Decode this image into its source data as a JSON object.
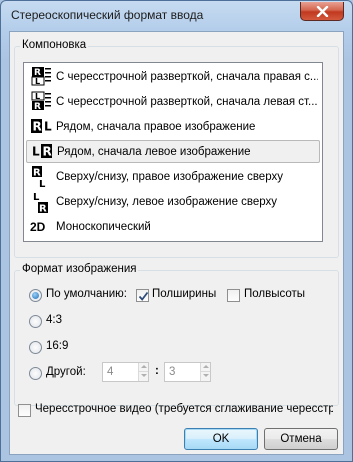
{
  "window": {
    "title": "Стереоскопический формат ввода"
  },
  "layout_group": {
    "label": "Компоновка",
    "items": [
      {
        "icon": "interlaced-right-first-icon",
        "label": "С чересстрочной разверткой, сначала правая с..."
      },
      {
        "icon": "interlaced-left-first-icon",
        "label": "С чересстрочной разверткой, сначала левая ст..."
      },
      {
        "icon": "side-by-side-right-first-icon",
        "label": "Рядом, сначала правое изображение"
      },
      {
        "icon": "side-by-side-left-first-icon",
        "label": "Рядом, сначала левое изображение",
        "selected": true
      },
      {
        "icon": "top-bottom-right-first-icon",
        "label": "Сверху/снизу, правое изображение сверху"
      },
      {
        "icon": "top-bottom-left-first-icon",
        "label": "Сверху/снизу, левое изображение сверху"
      },
      {
        "icon": "mono-2d-icon",
        "label": "Моноскопический",
        "icon_text": "2D"
      }
    ]
  },
  "image_format": {
    "label": "Формат изображения",
    "default_label": "По умолчанию:",
    "default_selected": true,
    "half_width_label": "Полширины",
    "half_width_checked": true,
    "half_height_label": "Полвысоты",
    "half_height_checked": false,
    "ratio_4_3_label": "4:3",
    "ratio_16_9_label": "16:9",
    "other_label": "Другой:",
    "other_width": "4",
    "other_separator": ":",
    "other_height": "3"
  },
  "interlaced_video": {
    "label": "Чересстрочное видео (требуется сглаживание чересстр",
    "checked": false
  },
  "buttons": {
    "ok": "OK",
    "cancel": "Отмена"
  },
  "icon_letters": {
    "r": "R",
    "l": "L"
  },
  "colors": {
    "titlebar": "#b9d1ea",
    "close_button": "#c7422a",
    "dialog_bg": "#f0f0f0",
    "default_button": "#3c7fb1"
  }
}
